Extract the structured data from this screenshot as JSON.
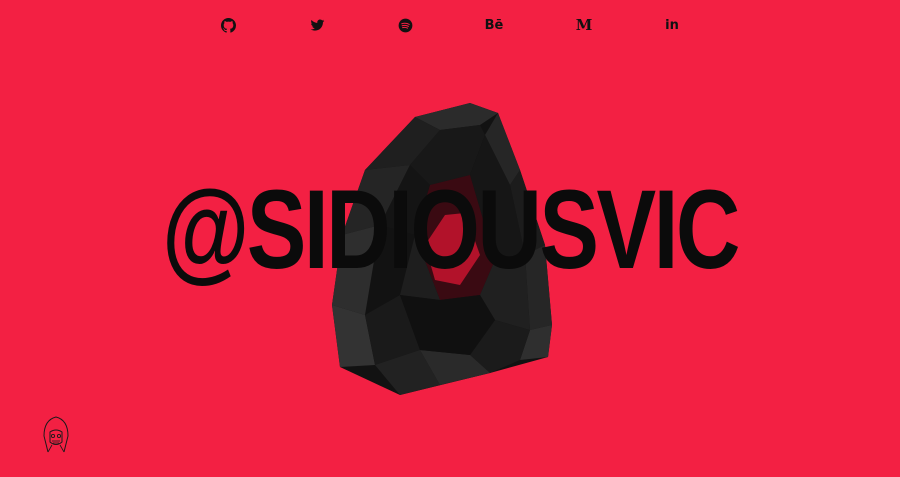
{
  "social": {
    "github": {
      "icon": "github-icon"
    },
    "twitter": {
      "icon": "twitter-icon"
    },
    "spotify": {
      "icon": "spotify-icon"
    },
    "behance": {
      "icon": "behance-icon",
      "glyph": "Bē"
    },
    "medium": {
      "icon": "medium-icon",
      "glyph": "M"
    },
    "linkedin": {
      "icon": "linkedin-icon",
      "glyph": "in"
    }
  },
  "hero": {
    "handle": "@SIDIOUSVIC",
    "helmet_icon": "sith-helmet-illustration"
  },
  "corner_logo": {
    "icon": "hooded-sith-logo-icon"
  },
  "colors": {
    "background": "#f32043",
    "text": "#0b0b0b",
    "helmet_dark": "#141414",
    "helmet_mid": "#2a2a2a",
    "helmet_light": "#3d3d3d"
  }
}
